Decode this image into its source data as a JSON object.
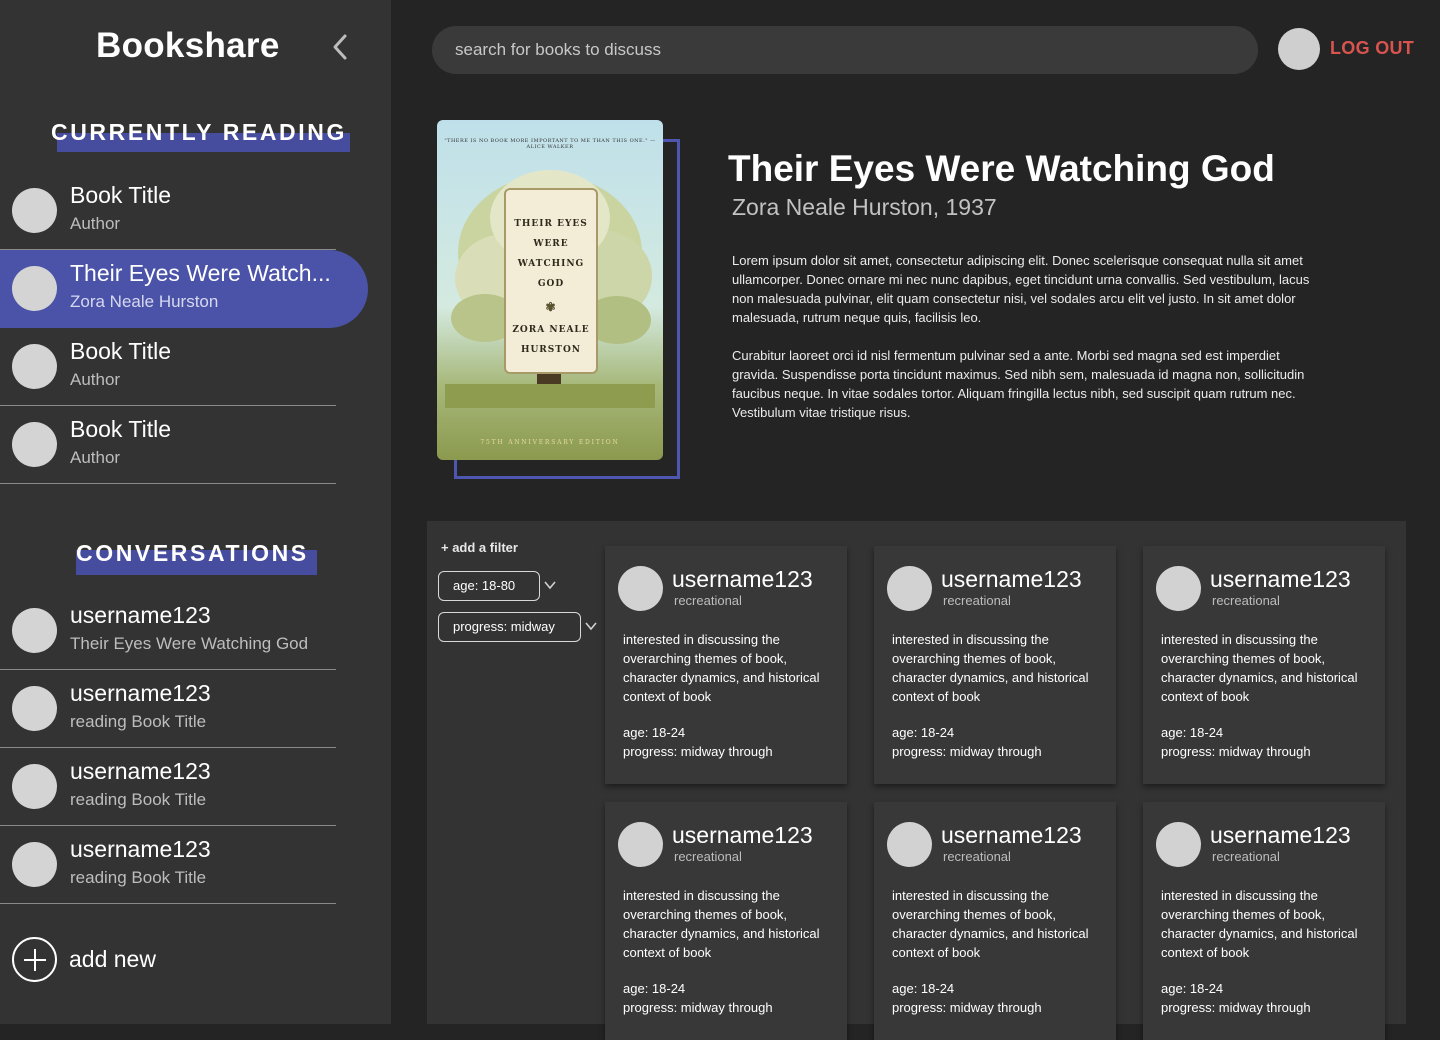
{
  "app": {
    "brand": "Bookshare"
  },
  "sidebar": {
    "currently_reading_heading": "CURRENTLY READING",
    "reading": [
      {
        "title": "Book Title",
        "author": "Author"
      },
      {
        "title": "Their Eyes Were Watch...",
        "author": "Zora Neale Hurston"
      },
      {
        "title": "Book Title",
        "author": "Author"
      },
      {
        "title": "Book Title",
        "author": "Author"
      }
    ],
    "conversations_heading": "CONVERSATIONS",
    "conversations": [
      {
        "user": "username123",
        "subtitle": "Their Eyes Were Watching God"
      },
      {
        "user": "username123",
        "subtitle": "reading Book Title"
      },
      {
        "user": "username123",
        "subtitle": "reading Book Title"
      },
      {
        "user": "username123",
        "subtitle": "reading Book Title"
      }
    ],
    "add_new_label": "add new"
  },
  "header": {
    "search_placeholder": "search for books to discuss",
    "logout_label": "LOG OUT"
  },
  "book": {
    "cover": {
      "quote": "\"THERE IS NO BOOK MORE IMPORTANT TO ME THAN THIS ONE.\" —ALICE WALKER",
      "title_lines": [
        "THEIR EYES",
        "WERE",
        "WATCHING",
        "GOD"
      ],
      "author_lines": [
        "ZORA NEALE",
        "HURSTON"
      ],
      "edition": "75TH ANNIVERSARY EDITION"
    },
    "title": "Their Eyes Were Watching God",
    "meta": "Zora Neale Hurston, 1937",
    "description": [
      "Lorem ipsum dolor sit amet, consectetur adipiscing elit. Donec scelerisque consequat nulla sit amet ullamcorper. Donec ornare mi nec nunc dapibus, eget tincidunt urna convallis. Sed vestibulum, lacus non malesuada pulvinar, elit quam consectetur nisi, vel sodales arcu elit vel justo. In sit amet dolor malesuada, rutrum neque quis, facilisis leo.",
      "Curabitur laoreet orci id nisl fermentum pulvinar sed a ante. Morbi sed magna sed est imperdiet gravida. Suspendisse porta tincidunt maximus. Sed nibh sem, malesuada id magna non, sollicitudin faucibus neque. In vitae sodales tortor. Aliquam fringilla lectus nibh, sed suscipit quam rutrum nec. Vestibulum vitae tristique risus."
    ]
  },
  "filters": {
    "add_label": "+ add a filter",
    "chips": [
      {
        "label": "age: 18-80"
      },
      {
        "label": "progress: midway"
      }
    ]
  },
  "discussions": [
    {
      "user": "username123",
      "type": "recreational",
      "interest": "interested in discussing the overarching themes of book, character dynamics,  and historical context of book",
      "age": "age: 18-24",
      "progress": "progress: midway through"
    },
    {
      "user": "username123",
      "type": "recreational",
      "interest": "interested in discussing the overarching themes of book, character dynamics,  and historical context of book",
      "age": "age: 18-24",
      "progress": "progress: midway through"
    },
    {
      "user": "username123",
      "type": "recreational",
      "interest": "interested in discussing the overarching themes of book, character dynamics,  and historical context of book",
      "age": "age: 18-24",
      "progress": "progress: midway through"
    },
    {
      "user": "username123",
      "type": "recreational",
      "interest": "interested in discussing the overarching themes of book, character dynamics,  and historical context of book",
      "age": "age: 18-24",
      "progress": "progress: midway through"
    },
    {
      "user": "username123",
      "type": "recreational",
      "interest": "interested in discussing the overarching themes of book, character dynamics,  and historical context of book",
      "age": "age: 18-24",
      "progress": "progress: midway through"
    },
    {
      "user": "username123",
      "type": "recreational",
      "interest": "interested in discussing the overarching themes of book, character dynamics,  and historical context of book",
      "age": "age: 18-24",
      "progress": "progress: midway through"
    }
  ],
  "colors": {
    "background": "#242424",
    "sidebar": "#333333",
    "accent": "#4b53a8",
    "logout": "#d9534f"
  },
  "icons": {
    "collapse": "chevron-left-icon",
    "add": "plus-circle-icon",
    "filter_dropdown": "chevron-down-icon"
  }
}
